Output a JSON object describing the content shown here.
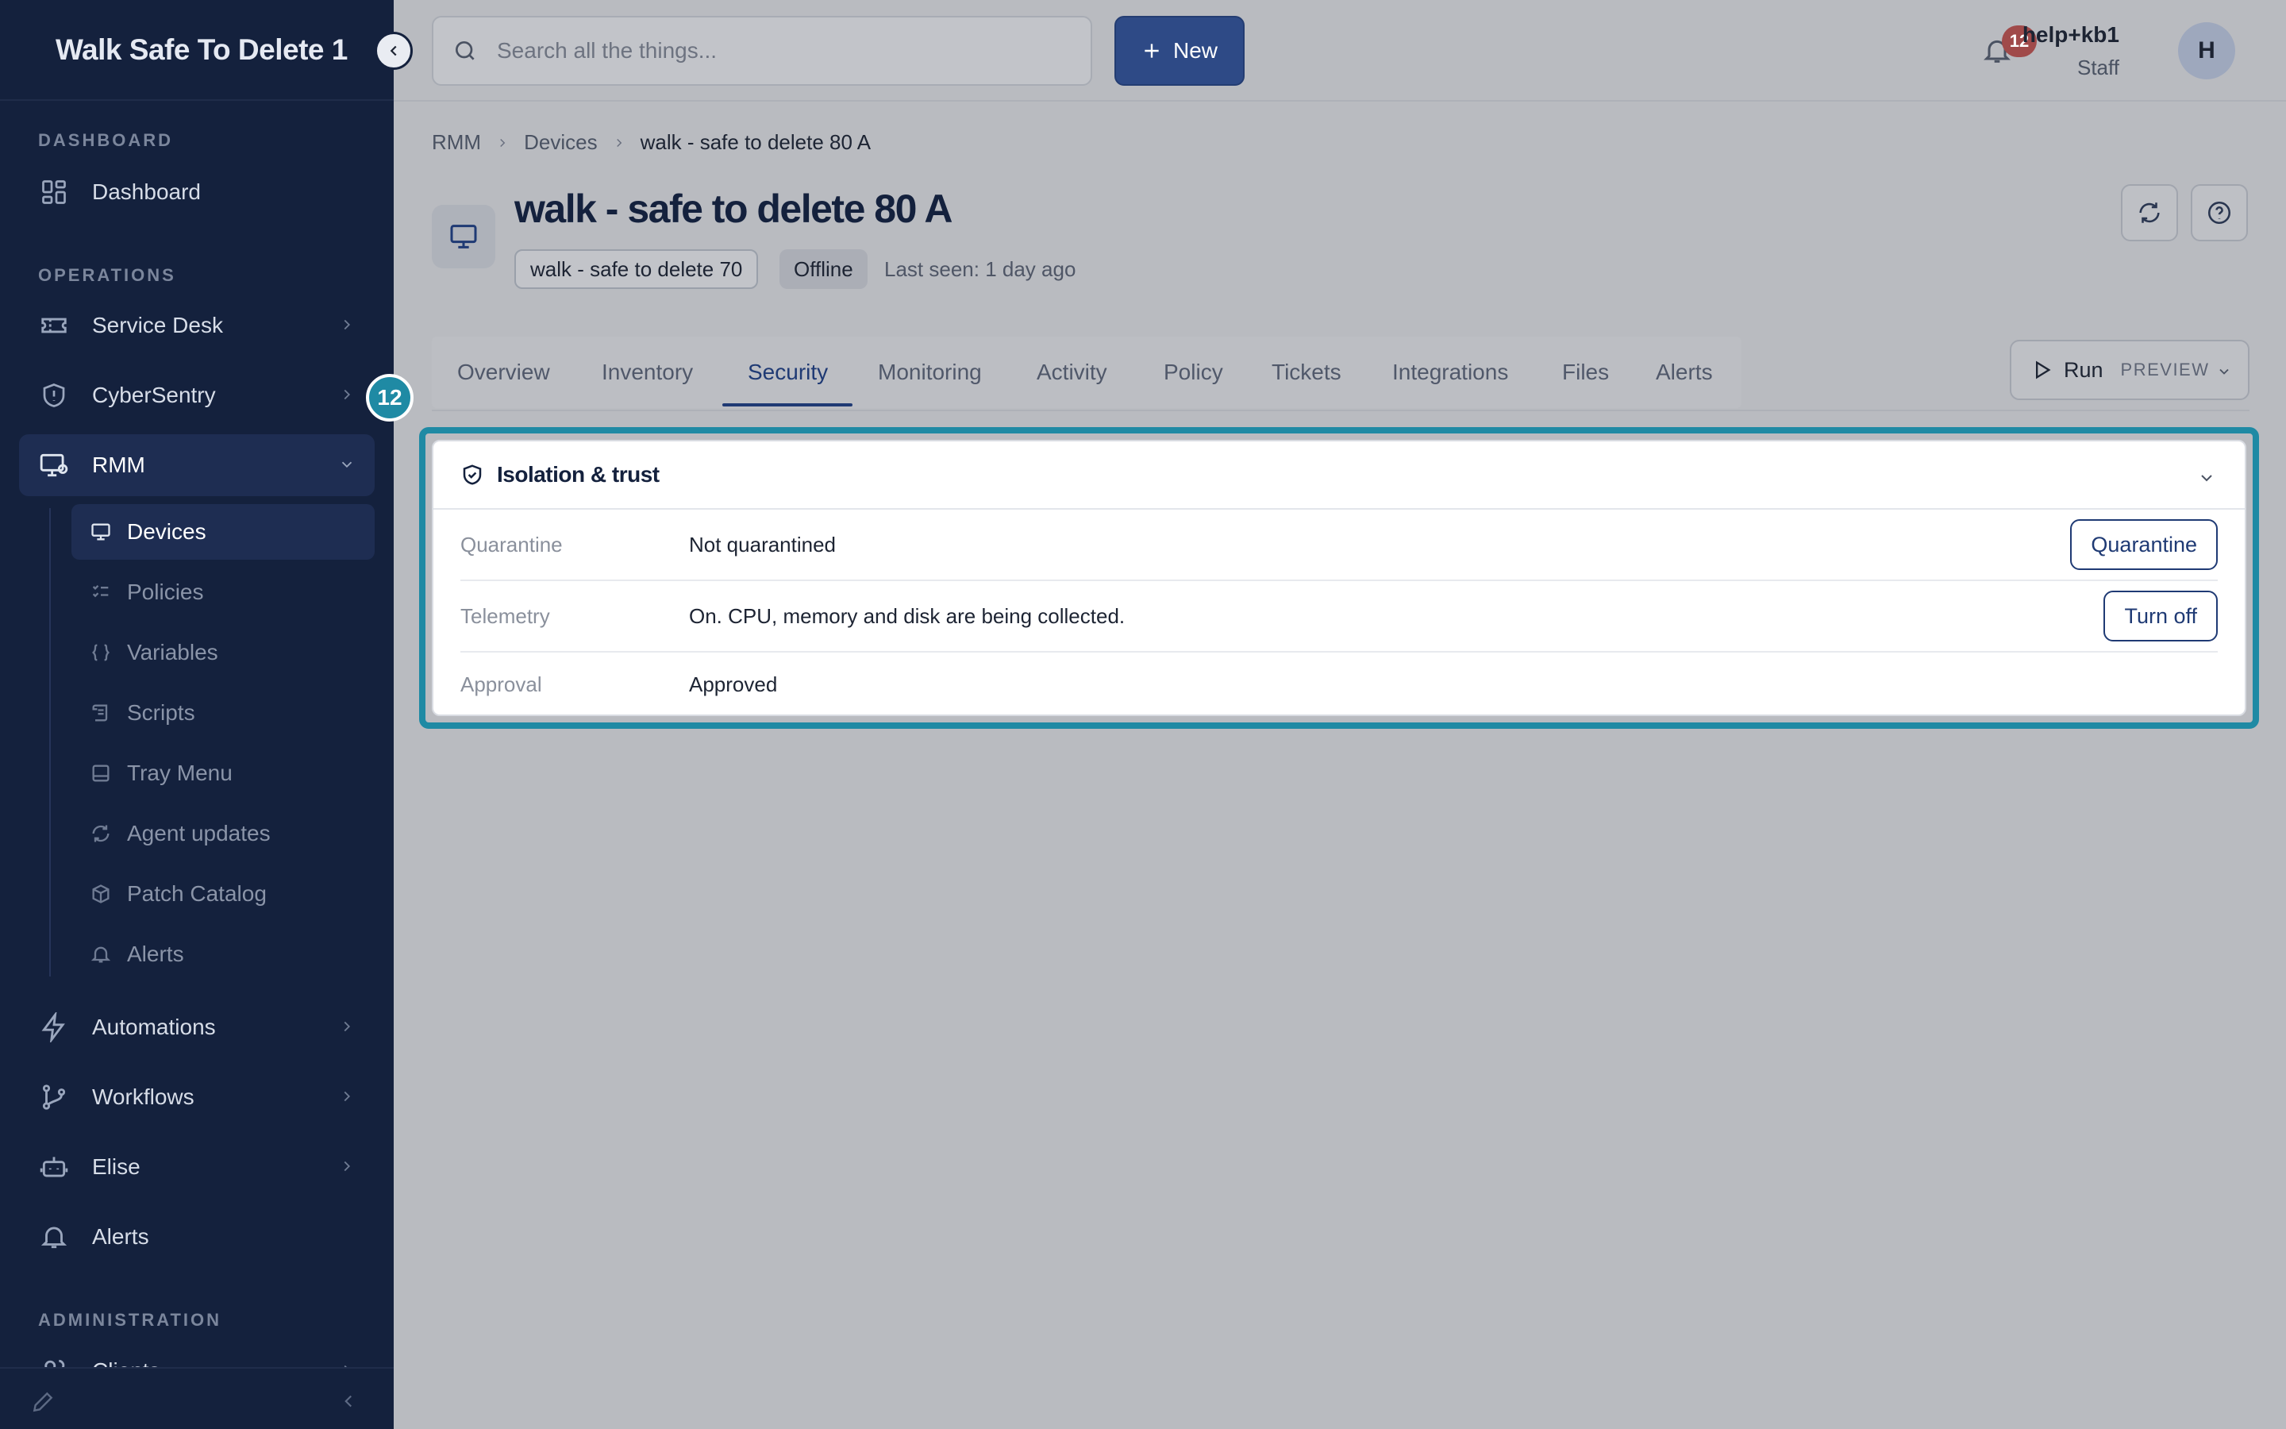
{
  "sidebar": {
    "brand": "Walk Safe To Delete 1",
    "sections": {
      "dashboard": "DASHBOARD",
      "operations": "OPERATIONS",
      "administration": "ADMINISTRATION"
    },
    "items": {
      "dashboard": "Dashboard",
      "service_desk": "Service Desk",
      "cybersentry": "CyberSentry",
      "rmm": "RMM",
      "automations": "Automations",
      "workflows": "Workflows",
      "elise": "Elise",
      "alerts": "Alerts",
      "clients": "Clients"
    },
    "rmm_sub": {
      "devices": "Devices",
      "policies": "Policies",
      "variables": "Variables",
      "scripts": "Scripts",
      "tray_menu": "Tray Menu",
      "agent_updates": "Agent updates",
      "patch_catalog": "Patch Catalog",
      "alerts": "Alerts"
    },
    "step_badge": "12"
  },
  "topbar": {
    "search_placeholder": "Search all the things...",
    "new_label": "New",
    "notifications_count": "12",
    "user_name": "help+kb1",
    "user_role": "Staff",
    "avatar_initial": "H"
  },
  "breadcrumb": [
    "RMM",
    "Devices",
    "walk - safe to delete 80 A"
  ],
  "device": {
    "title": "walk - safe to delete 80 A",
    "alias": "walk - safe to delete 70",
    "status": "Offline",
    "last_seen": "Last seen: 1 day ago"
  },
  "tabs": [
    "Overview",
    "Inventory",
    "Security",
    "Monitoring",
    "Activity",
    "Policy",
    "Tickets",
    "Integrations",
    "Files",
    "Alerts"
  ],
  "active_tab": "Security",
  "run": {
    "label": "Run",
    "badge": "PREVIEW"
  },
  "card": {
    "title": "Isolation & trust",
    "rows": [
      {
        "label": "Quarantine",
        "value": "Not quarantined",
        "action": "Quarantine"
      },
      {
        "label": "Telemetry",
        "value": "On. CPU, memory and disk are being collected.",
        "action": "Turn off"
      },
      {
        "label": "Approval",
        "value": "Approved",
        "action": ""
      }
    ]
  },
  "colors": {
    "sidebar_bg": "#14213d",
    "accent": "#2e4a86",
    "focus": "#1f8aa4",
    "notification": "#a04a4a"
  }
}
